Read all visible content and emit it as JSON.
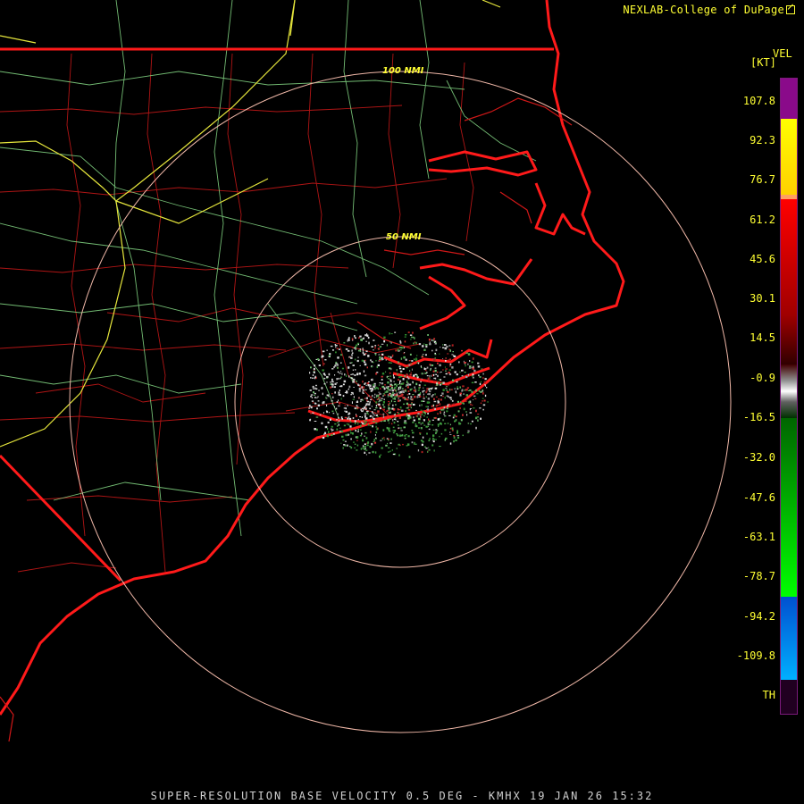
{
  "header": {
    "credit": "NEXLAB-College of DuPage"
  },
  "legend": {
    "product": "VEL",
    "unit": "[KT]",
    "ticks": [
      "107.8",
      "92.3",
      "76.7",
      "61.2",
      "45.6",
      "30.1",
      "14.5",
      "-0.9",
      "-16.5",
      "-32.0",
      "-47.6",
      "-63.1",
      "-78.7",
      "-94.2",
      "-109.8",
      "TH"
    ],
    "colors": [
      "#8a0a8a",
      "#ffff00",
      "#ffa060",
      "#ff0000",
      "#a00000",
      "#300000",
      "#c0c0c0",
      "#006600",
      "#00ff00",
      "#0050d0",
      "#00b0ff",
      "#200020"
    ]
  },
  "map": {
    "rings": [
      {
        "label": "100 NMI",
        "radius_nmi": 100
      },
      {
        "label": "50 NMI",
        "radius_nmi": 50
      }
    ]
  },
  "footer": {
    "caption": "SUPER-RESOLUTION BASE VELOCITY 0.5 DEG - KMHX 19 JAN 26 15:32"
  }
}
